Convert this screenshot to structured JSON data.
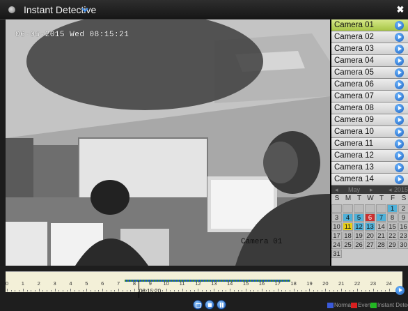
{
  "app": {
    "title": "Instant Detective",
    "close_glyph": "✖"
  },
  "video": {
    "timestamp": "06-05-2015 Wed 08:15:21",
    "camera_label": "Camera 01"
  },
  "camera_list": {
    "items": [
      {
        "label": "Camera 01",
        "selected": true
      },
      {
        "label": "Camera 02"
      },
      {
        "label": "Camera 03"
      },
      {
        "label": "Camera 04"
      },
      {
        "label": "Camera 05"
      },
      {
        "label": "Camera 06"
      },
      {
        "label": "Camera 07"
      },
      {
        "label": "Camera 08"
      },
      {
        "label": "Camera 09"
      },
      {
        "label": "Camera 10"
      },
      {
        "label": "Camera 11"
      },
      {
        "label": "Camera 12"
      },
      {
        "label": "Camera 13"
      },
      {
        "label": "Camera 14"
      }
    ],
    "play_icon": "play-circle-icon"
  },
  "calendar": {
    "prev_month": "◂",
    "month": "May",
    "next_month": "▸",
    "prev_year": "◂",
    "year": "2015",
    "weekdays": [
      "S",
      "M",
      "T",
      "W",
      "T",
      "F",
      "S"
    ],
    "days": [
      {
        "d": "",
        "s": "blank"
      },
      {
        "d": "",
        "s": "blank"
      },
      {
        "d": "",
        "s": "blank"
      },
      {
        "d": "",
        "s": "blank"
      },
      {
        "d": "",
        "s": "blank"
      },
      {
        "d": "1",
        "s": "rec"
      },
      {
        "d": "2",
        "s": "normal"
      },
      {
        "d": "3",
        "s": "normal"
      },
      {
        "d": "4",
        "s": "rec"
      },
      {
        "d": "5",
        "s": "rec"
      },
      {
        "d": "6",
        "s": "event"
      },
      {
        "d": "7",
        "s": "rec"
      },
      {
        "d": "8",
        "s": "normal"
      },
      {
        "d": "9",
        "s": "normal"
      },
      {
        "d": "10",
        "s": "normal"
      },
      {
        "d": "11",
        "s": "today"
      },
      {
        "d": "12",
        "s": "rec"
      },
      {
        "d": "13",
        "s": "rec"
      },
      {
        "d": "14",
        "s": "normal"
      },
      {
        "d": "15",
        "s": "normal"
      },
      {
        "d": "16",
        "s": "normal"
      },
      {
        "d": "17",
        "s": "normal"
      },
      {
        "d": "18",
        "s": "normal"
      },
      {
        "d": "19",
        "s": "normal"
      },
      {
        "d": "20",
        "s": "normal"
      },
      {
        "d": "21",
        "s": "normal"
      },
      {
        "d": "22",
        "s": "normal"
      },
      {
        "d": "23",
        "s": "normal"
      },
      {
        "d": "24",
        "s": "normal"
      },
      {
        "d": "25",
        "s": "normal"
      },
      {
        "d": "26",
        "s": "normal"
      },
      {
        "d": "27",
        "s": "normal"
      },
      {
        "d": "28",
        "s": "normal"
      },
      {
        "d": "29",
        "s": "normal"
      },
      {
        "d": "30",
        "s": "normal"
      },
      {
        "d": "31",
        "s": "normal"
      }
    ],
    "colors": {
      "recording": "#4fb1d9",
      "event": "#c93030",
      "today": "#e7cf1a"
    }
  },
  "timeline": {
    "cursor_time": "08:15:20",
    "hours": [
      "0",
      "1",
      "2",
      "3",
      "4",
      "5",
      "6",
      "7",
      "8",
      "9",
      "10",
      "11",
      "12",
      "13",
      "14",
      "15",
      "16",
      "17",
      "18",
      "19",
      "20",
      "21",
      "22",
      "23",
      "24"
    ],
    "recording_start_hour": 7.4,
    "recording_end_hour": 17.8,
    "cursor_hour": 8.26
  },
  "controls": {
    "snapshot_icon": "camera-icon",
    "stop_icon": "stop-icon",
    "pause_icon": "pause-icon"
  },
  "legend": {
    "items": [
      {
        "label": "Normal",
        "color": "#3a5ad9"
      },
      {
        "label": "Event",
        "color": "#d92020"
      },
      {
        "label": "Instant Detect",
        "color": "#22b822"
      }
    ]
  }
}
